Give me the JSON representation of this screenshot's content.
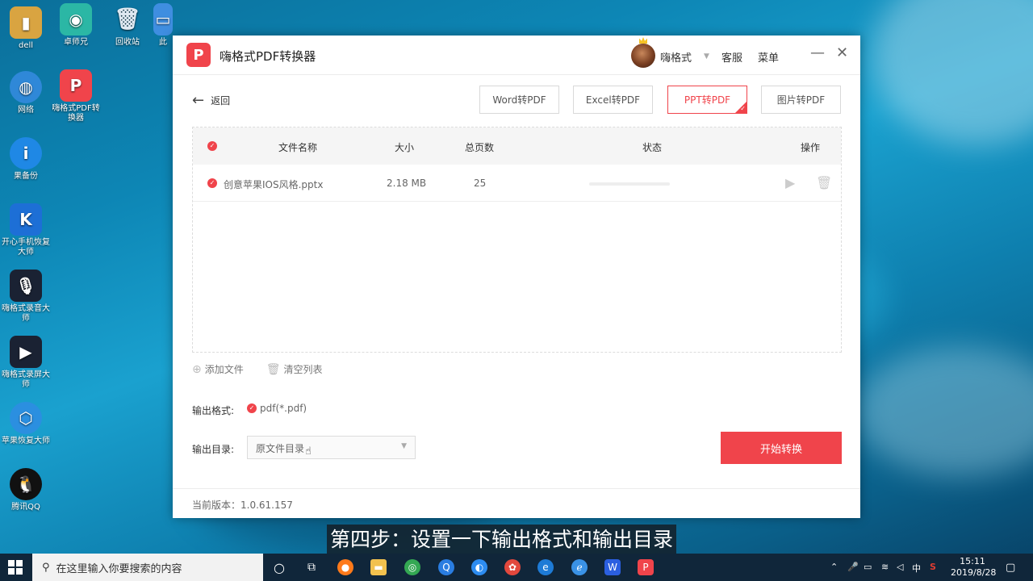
{
  "desktop": {
    "icons": [
      {
        "label": "dell",
        "color": "#d9a441"
      },
      {
        "label": "卓师兄",
        "color": "#2bb7a5"
      },
      {
        "label": "回收站",
        "color": "#9fb8cc"
      },
      {
        "label": "此",
        "color": "#3f8ee0"
      },
      {
        "label": "网络",
        "color": "#2f88d8"
      },
      {
        "label": "嗨格式PDF转换器",
        "color": "#f0444b"
      },
      {
        "label": "果备份",
        "color": "#1f88e5"
      },
      {
        "label": "开心手机恢复大师",
        "color": "#1d6fd6"
      },
      {
        "label": "嗨格式录音大师",
        "color": "#1a2233"
      },
      {
        "label": "嗨格式录屏大师",
        "color": "#1a2233"
      },
      {
        "label": "苹果恢复大师",
        "color": "#2b8fe0"
      },
      {
        "label": "腾讯QQ",
        "color": "#111111"
      }
    ]
  },
  "window": {
    "title": "嗨格式PDF转换器",
    "user": "嗨格式",
    "service": "客服",
    "menu": "菜单",
    "minimize": "—",
    "close": "✕",
    "back_label": "返回",
    "tabs": [
      "Word转PDF",
      "Excel转PDF",
      "PPT转PDF",
      "图片转PDF"
    ],
    "active_tab_index": 2,
    "table": {
      "headers": {
        "name": "文件名称",
        "size": "大小",
        "pages": "总页数",
        "status": "状态",
        "ops": "操作"
      },
      "rows": [
        {
          "name": "创意苹果IOS风格.pptx",
          "size": "2.18 MB",
          "pages": "25",
          "progress": 0
        }
      ]
    },
    "add_file": "添加文件",
    "clear_list": "清空列表",
    "output_format_label": "输出格式:",
    "output_format_value": "pdf(*.pdf)",
    "output_dir_label": "输出目录:",
    "output_dir_value": "原文件目录",
    "start_button": "开始转换",
    "version": "当前版本：1.0.61.157"
  },
  "subtitle": "第四步：设置一下输出格式和输出目录",
  "taskbar": {
    "search_placeholder": "在这里输入你要搜索的内容",
    "ime": "中",
    "time": "15:11",
    "date": "2019/8/28"
  },
  "colors": {
    "accent": "#f0444b"
  }
}
